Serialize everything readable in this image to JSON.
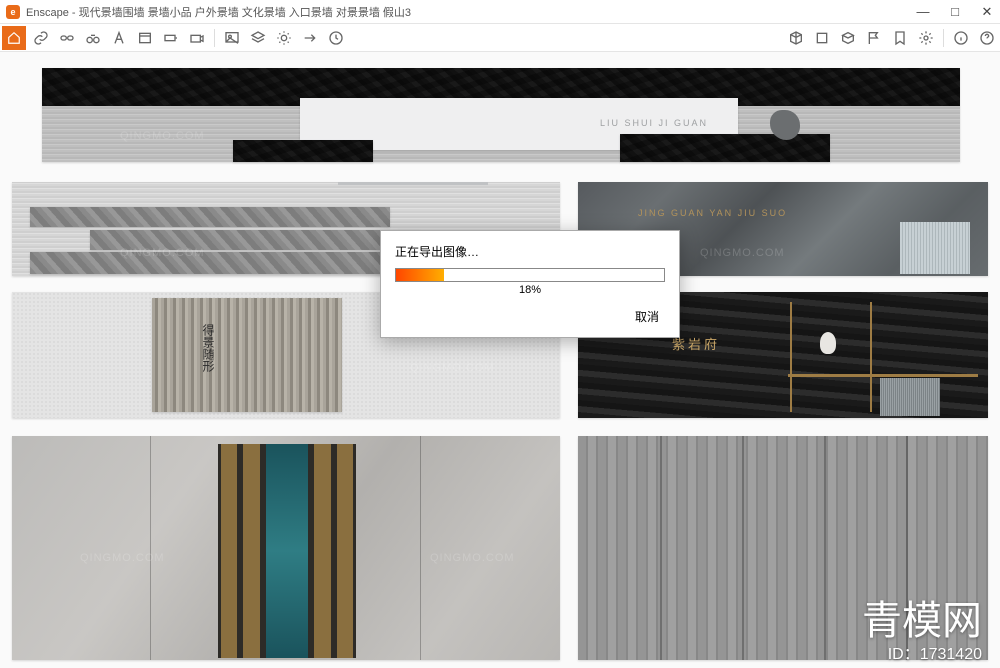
{
  "window": {
    "app": "Enscape",
    "title": "Enscape - 现代景墙围墙 景墙小品 户外景墙 文化景墙 入口景墙 对景景墙 假山3"
  },
  "win_controls": {
    "min": "—",
    "max": "□",
    "close": "✕"
  },
  "toolbar": {
    "home": "home-icon",
    "left_icons": [
      "link-icon",
      "chain-icon",
      "binoculars-icon",
      "a-text-icon",
      "panel-icon",
      "battery-icon",
      "camera-icon"
    ],
    "mid_icons": [
      "image-export-icon",
      "layers-icon",
      "sun-icon",
      "arrow-right-icon",
      "clock-icon"
    ],
    "right_icons": [
      "cube-sync-icon",
      "cube-icon",
      "box-icon",
      "flag-icon",
      "bookmark-icon",
      "gear-icon",
      "info-icon",
      "help-icon"
    ]
  },
  "dialog": {
    "title": "正在导出图像…",
    "percent_value": 18,
    "percent_label": "18%",
    "cancel_label": "取消"
  },
  "scene_text": {
    "wall_top_label": "LIU SHUI  JI GUAN",
    "wall_marble_label": "JING GUAN YAN JIU SUO",
    "wall_charcoal_label": "紫岩府"
  },
  "watermark_text": "QINGMO.COM",
  "brand": {
    "name": "青模网",
    "id_prefix": "ID：",
    "id_value": "1731420"
  },
  "colors": {
    "accent": "#e96b19",
    "progress_start": "#ff4600",
    "progress_end": "#ffae00"
  }
}
